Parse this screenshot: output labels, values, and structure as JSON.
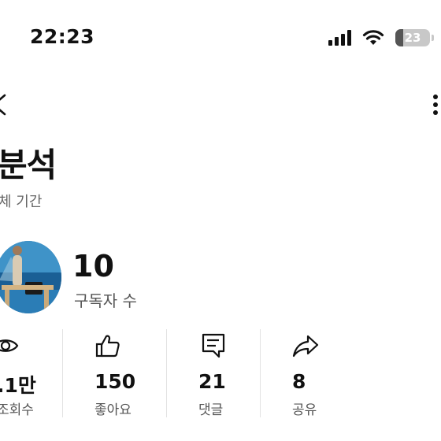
{
  "status_bar": {
    "time": "22:23",
    "battery": "23",
    "battery_level": 0.23
  },
  "header": {
    "title": "분석",
    "period": "체 기간"
  },
  "channel": {
    "subscriber_count": "10",
    "subscriber_label": "구독자 수"
  },
  "stats": [
    {
      "icon": "eye-icon",
      "value": ".1만",
      "label": "조회수"
    },
    {
      "icon": "thumbs-up-icon",
      "value": "150",
      "label": "좋아요"
    },
    {
      "icon": "comment-icon",
      "value": "21",
      "label": "댓글"
    },
    {
      "icon": "share-icon",
      "value": "8",
      "label": "공유"
    }
  ]
}
